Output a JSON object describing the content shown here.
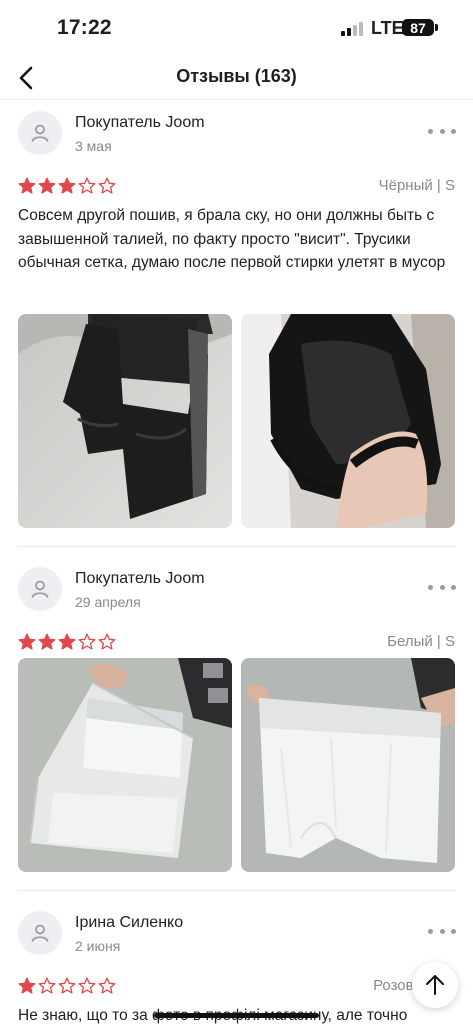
{
  "status_bar": {
    "time": "17:22",
    "network": "LTE",
    "battery": "87"
  },
  "header": {
    "title": "Отзывы (163)",
    "back_icon": "chevron-left-icon"
  },
  "colors": {
    "star_filled": "#e0474c",
    "star_empty": "#e0474c",
    "text_secondary": "#8a8a8a"
  },
  "reviews": [
    {
      "author": "Покупатель Joom",
      "date": "3 мая",
      "rating": 3,
      "max_rating": 5,
      "variant": "Чёрный | S",
      "text": "Совсем другой пошив, я брала ску, но они должны быть с завышенной талией, по факту просто \"висит\". Трусики обычная сетка, думаю после первой стирки улетят в мусор",
      "photos": 2
    },
    {
      "author": "Покупатель Joom",
      "date": "29 апреля",
      "rating": 3,
      "max_rating": 5,
      "variant": "Белый | S",
      "text": "",
      "photos": 2
    },
    {
      "author": "Ірина Силенко",
      "date": "2 июня",
      "rating": 1,
      "max_rating": 5,
      "variant": "Розовый | S",
      "text": "Не знаю, що то за фото в профілі магазину, але точно",
      "photos": 0
    }
  ]
}
